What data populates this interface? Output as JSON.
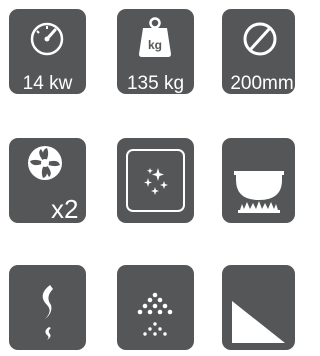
{
  "tiles": [
    {
      "id": "power",
      "icon": "gauge-icon",
      "label": "14 kw"
    },
    {
      "id": "weight",
      "icon": "weight-kg-icon",
      "icon_text": "kg",
      "label": "135 kg"
    },
    {
      "id": "diameter",
      "icon": "diameter-icon",
      "label": "200mm"
    },
    {
      "id": "fans",
      "icon": "fan-icon",
      "label": "x2"
    },
    {
      "id": "clean",
      "icon": "sparkle-glass-icon"
    },
    {
      "id": "hob",
      "icon": "pot-flame-icon"
    },
    {
      "id": "smoke",
      "icon": "smoke-icon"
    },
    {
      "id": "dots",
      "icon": "dot-pattern-icon"
    },
    {
      "id": "slope",
      "icon": "triangle-icon"
    }
  ],
  "colors": {
    "tile_bg": "#555657",
    "icon": "#ffffff"
  }
}
